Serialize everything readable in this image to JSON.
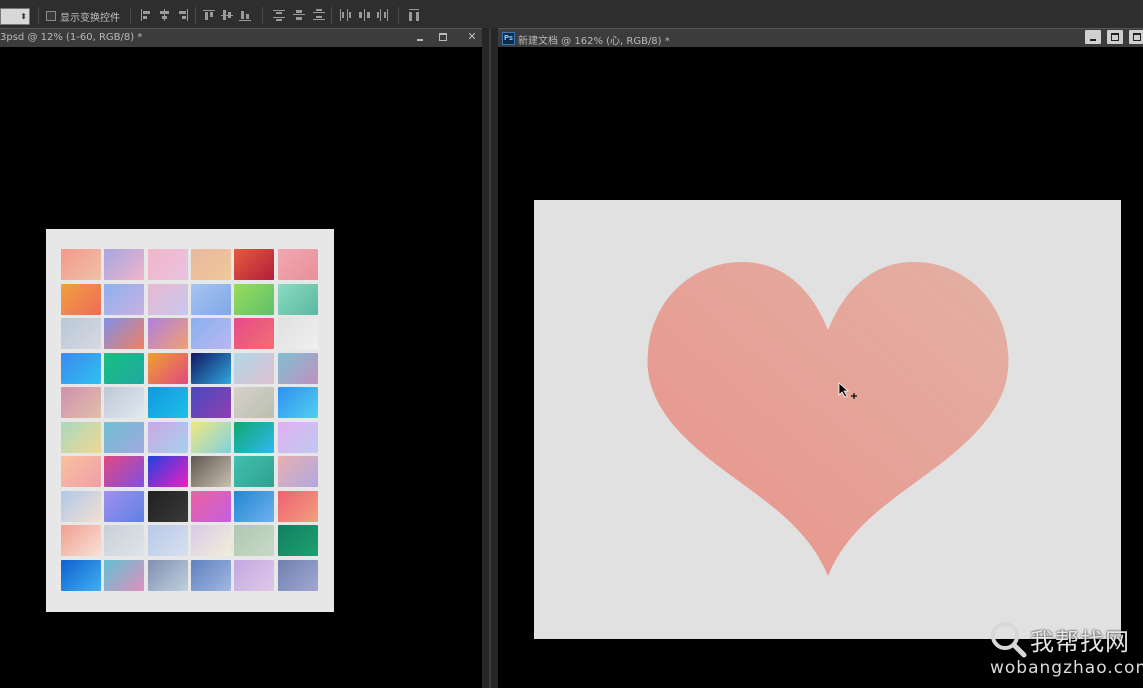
{
  "options_bar": {
    "show_transform_controls_label": "显示变换控件",
    "show_transform_controls_checked": false
  },
  "documents": [
    {
      "title": "3psd @ 12% (1-60, RGB/8) *",
      "controls": [
        "minimize",
        "restore",
        "close"
      ],
      "swatch_grid": {
        "columns": 6,
        "rows": 10,
        "gradients": [
          [
            "#f29a8a",
            "#f0c0a8"
          ],
          [
            "#a6a6e2",
            "#f0b4c8"
          ],
          [
            "#f2b4c8",
            "#e8c4e0"
          ],
          [
            "#e8b8a0",
            "#f0c898"
          ],
          [
            "#e65a3c",
            "#b21e3c"
          ],
          [
            "#f0a8b4",
            "#e89098"
          ],
          [
            "#f0a040",
            "#ef6b5a"
          ],
          [
            "#8fb0ee",
            "#c8b0e0"
          ],
          [
            "#e8b8d0",
            "#c8c8ee"
          ],
          [
            "#a6c4f0",
            "#80a8e8"
          ],
          [
            "#9adc5a",
            "#5ec06c"
          ],
          [
            "#8adcc0",
            "#5ab8a0"
          ],
          [
            "#b8c8d8",
            "#d8d8e0"
          ],
          [
            "#8090e8",
            "#f08060"
          ],
          [
            "#b080e0",
            "#f0a070"
          ],
          [
            "#8ab0f0",
            "#b8b8f0"
          ],
          [
            "#e84a8a",
            "#f07070"
          ],
          [
            "#e0e0e0",
            "#f0f0f0"
          ],
          [
            "#3a8af0",
            "#30c0f0"
          ],
          [
            "#18c080",
            "#20a8a0"
          ],
          [
            "#f0a030",
            "#e04880"
          ],
          [
            "#101860",
            "#30a8e0"
          ],
          [
            "#b0d8e8",
            "#e0c0d0"
          ],
          [
            "#80c0d0",
            "#c090c0"
          ],
          [
            "#d090b0",
            "#e0c0a8"
          ],
          [
            "#c0c8d8",
            "#e0e8f0"
          ],
          [
            "#1098e0",
            "#20c0e8"
          ],
          [
            "#4848c0",
            "#9040b0"
          ],
          [
            "#d8d0c8",
            "#b8c0b0"
          ],
          [
            "#3090f0",
            "#50d0f0"
          ],
          [
            "#a8d8c0",
            "#f0d890"
          ],
          [
            "#70c0d0",
            "#a0a8e0"
          ],
          [
            "#c8a8e0",
            "#a8d0f0"
          ],
          [
            "#f0e880",
            "#80d0e0"
          ],
          [
            "#10a870",
            "#30b8f0"
          ],
          [
            "#e0b0f0",
            "#c0c8f0"
          ],
          [
            "#f8c0a0",
            "#f0a0a8"
          ],
          [
            "#e04880",
            "#8050e0"
          ],
          [
            "#2040e0",
            "#f020c0"
          ],
          [
            "#605850",
            "#c8c0b0"
          ],
          [
            "#40c0b0",
            "#30a090"
          ],
          [
            "#e8b0b0",
            "#b0a8e0"
          ],
          [
            "#b0c8e8",
            "#f0e0d0"
          ],
          [
            "#a090f0",
            "#6080e0"
          ],
          [
            "#202020",
            "#3a3a3a"
          ],
          [
            "#f060a0",
            "#c060e0"
          ],
          [
            "#2088d0",
            "#70b0f0"
          ],
          [
            "#f06070",
            "#f0a080"
          ],
          [
            "#f0a090",
            "#f8e0d8"
          ],
          [
            "#c8d0d8",
            "#e0e4e8"
          ],
          [
            "#b8c8e8",
            "#d8e0f0"
          ],
          [
            "#d8c8e8",
            "#f0f0d8"
          ],
          [
            "#b0c8b0",
            "#c8d8c8"
          ],
          [
            "#108060",
            "#20a070"
          ],
          [
            "#1060d0",
            "#40b0f0"
          ],
          [
            "#60c0d0",
            "#e090c0"
          ],
          [
            "#8090b0",
            "#c0d0e0"
          ],
          [
            "#6080c0",
            "#a0b8e0"
          ],
          [
            "#c0a8e0",
            "#e0c8e8"
          ],
          [
            "#7080b0",
            "#a0a8d0"
          ]
        ]
      }
    },
    {
      "title": "新建文档 @ 162% (心, RGB/8) *",
      "controls": [
        "minimize",
        "restore"
      ],
      "shape": "heart",
      "heart_gradient": [
        "#e8938a",
        "#e4b0a4"
      ]
    }
  ],
  "watermark": {
    "name": "我帮找网",
    "url": "wobangzhao.com"
  }
}
